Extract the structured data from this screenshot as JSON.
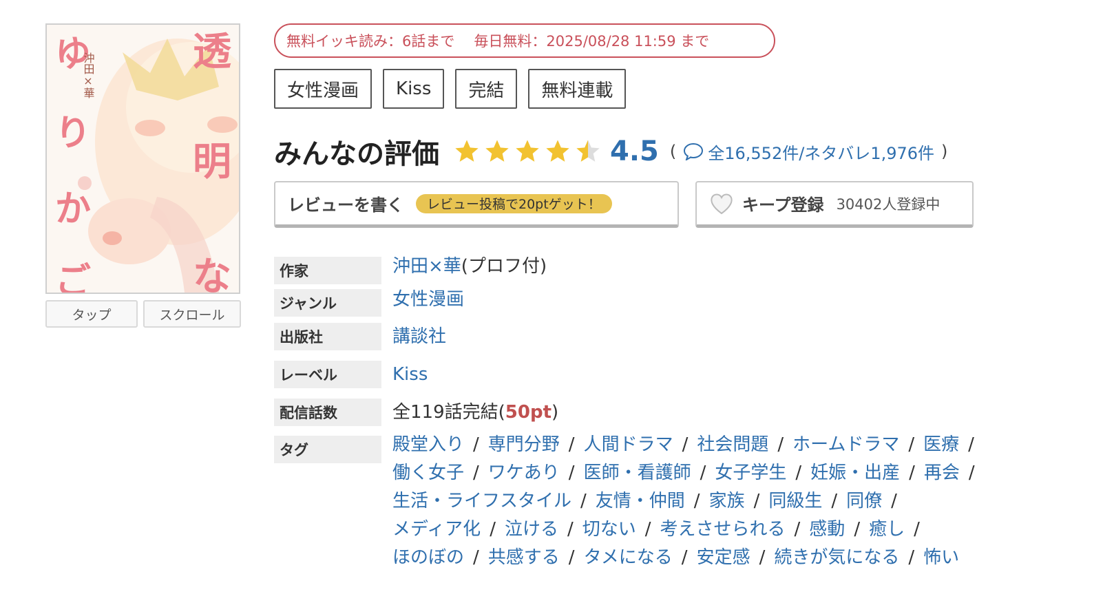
{
  "cover": {
    "title_chars": [
      "透",
      "明",
      "な",
      "ゆ",
      "り",
      "か",
      "ご"
    ],
    "author_text": "沖田×華",
    "tap_label": "タップ",
    "scroll_label": "スクロール"
  },
  "free_info": {
    "binge": "無料イッキ読み：6話まで",
    "daily": "毎日無料：2025/08/28 11:59 まで"
  },
  "category_tags": [
    "女性漫画",
    "Kiss",
    "完結",
    "無料連載"
  ],
  "rating": {
    "title": "みんなの評価",
    "score": "4.5",
    "stars_value": 4.5,
    "open_paren": "(",
    "close_paren": ")",
    "count_text": "全16,552件/ネタバレ1,976件"
  },
  "review_button": {
    "label": "レビューを書く",
    "bonus": "レビュー投稿で20ptゲット！"
  },
  "keep_button": {
    "label": "キープ登録",
    "count": "30402人登録中"
  },
  "info": {
    "author_label": "作家",
    "author_value": "沖田×華",
    "author_suffix": "(プロフ付)",
    "genre_label": "ジャンル",
    "genre_value": "女性漫画",
    "publisher_label": "出版社",
    "publisher_value": "講談社",
    "label_label": "レーベル",
    "label_value": "Kiss",
    "episodes_label": "配信話数",
    "episodes_prefix": "全119話完結(",
    "episodes_pt": "50pt",
    "episodes_suffix": ")",
    "tags_label": "タグ"
  },
  "tag_lines": [
    [
      "殿堂入り",
      "専門分野",
      "人間ドラマ",
      "社会問題",
      "ホームドラマ",
      "医療"
    ],
    [
      "働く女子",
      "ワケあり",
      "医師・看護師",
      "女子学生",
      "妊娠・出産",
      "再会"
    ],
    [
      "生活・ライフスタイル",
      "友情・仲間",
      "家族",
      "同級生",
      "同僚"
    ],
    [
      "メディア化",
      "泣ける",
      "切ない",
      "考えさせられる",
      "感動",
      "癒し"
    ],
    [
      "ほのぼの",
      "共感する",
      "タメになる",
      "安定感",
      "続きが気になる",
      "怖い"
    ]
  ],
  "tag_separator": "/",
  "colors": {
    "link": "#2f6fae",
    "free_pill": "#c9505a",
    "star": "#f2c230",
    "bonus_bg": "#e8c452",
    "pt": "#c0504f"
  }
}
